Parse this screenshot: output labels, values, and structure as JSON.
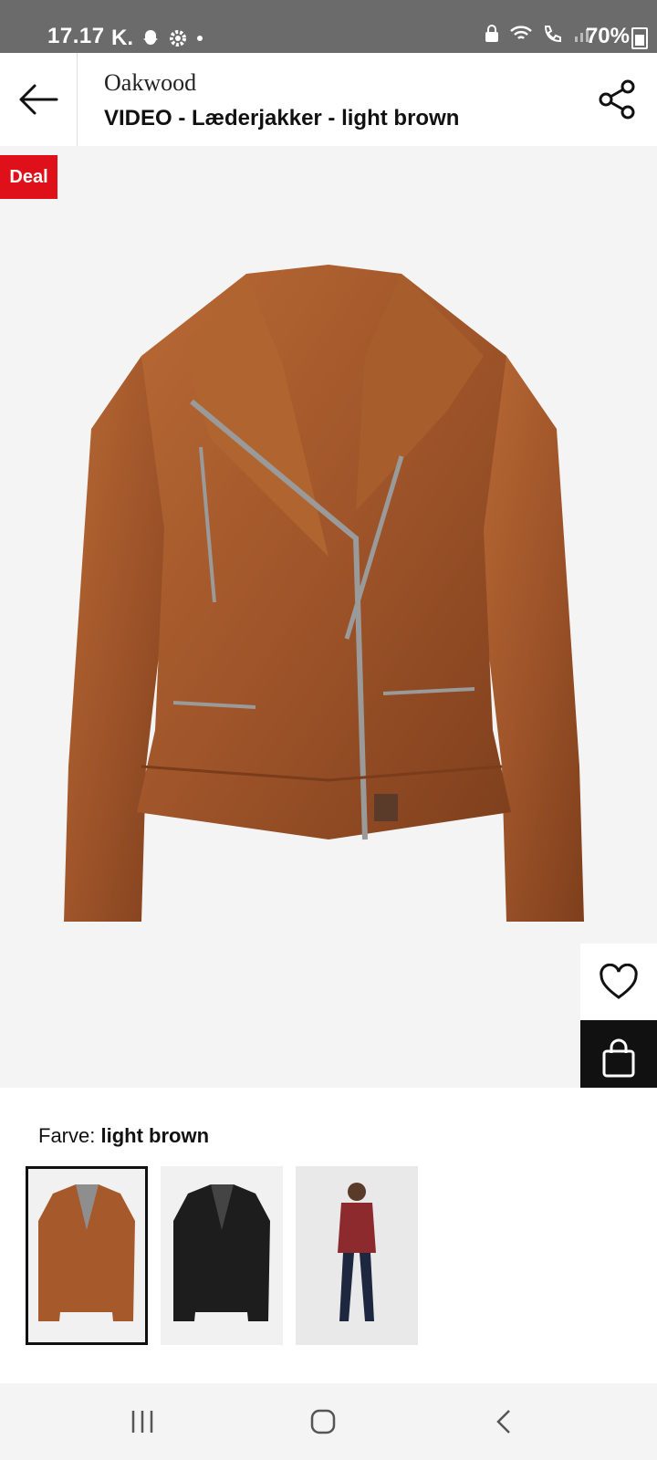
{
  "status_bar": {
    "time": "17.17",
    "carrier_mark": "K.",
    "battery": "70%",
    "icons": [
      "snapchat-icon",
      "settings-icon",
      "dot-icon",
      "lock-icon",
      "wifi-icon",
      "call-icon",
      "signal-icon",
      "battery-icon"
    ]
  },
  "header": {
    "brand": "Oakwood",
    "title": "VIDEO - Læderjakker - light brown",
    "back_icon": "arrow-left-icon",
    "share_icon": "share-icon"
  },
  "product": {
    "deal_badge": "Deal",
    "image": "brown-leather-jacket",
    "favorite_icon": "heart-icon",
    "bag_icon": "shopping-bag-icon"
  },
  "colors": {
    "label": "Farve:",
    "selected": "light brown",
    "swatches": [
      {
        "name": "light brown",
        "color": "#a65a2c"
      },
      {
        "name": "black",
        "color": "#1d1d1d"
      },
      {
        "name": "model-red",
        "color": "#8c2a2e"
      }
    ]
  },
  "nav": {
    "recent_icon": "recent-apps-icon",
    "home_icon": "home-icon",
    "back_icon": "back-chevron-icon"
  },
  "theme": {
    "accent": "#e0101a",
    "jacket": "#a65a2c"
  }
}
